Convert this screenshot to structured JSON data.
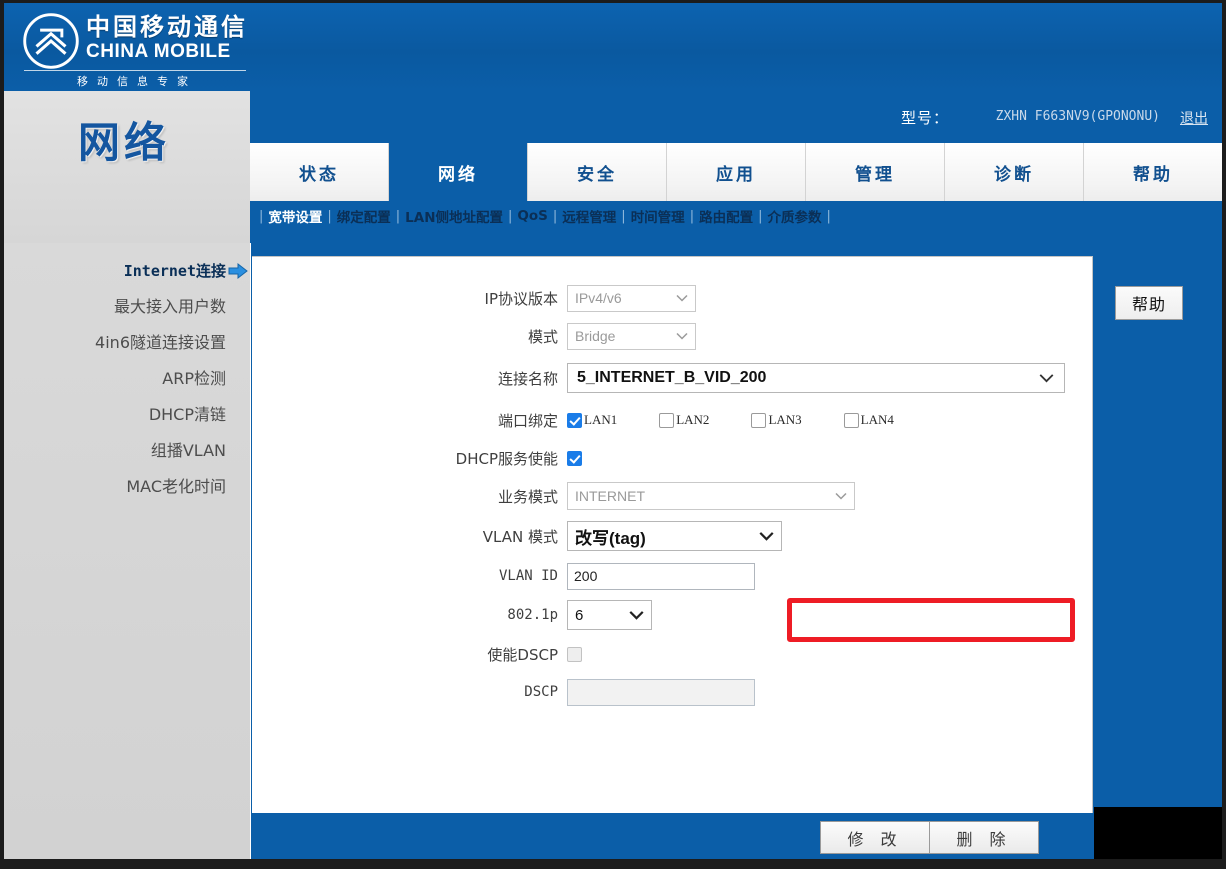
{
  "brand": {
    "name_cn": "中国移动通信",
    "name_en": "CHINA MOBILE",
    "slogan": "移动信息专家",
    "logo_icon": "china-mobile-logo-icon"
  },
  "header": {
    "model_label": "型号：",
    "model_value": "ZXHN F663NV9(GPONONU)",
    "logout_label": "退出"
  },
  "page": {
    "title": "网络"
  },
  "tabs": [
    {
      "label": "状态",
      "active": false
    },
    {
      "label": "网络",
      "active": true
    },
    {
      "label": "安全",
      "active": false
    },
    {
      "label": "应用",
      "active": false
    },
    {
      "label": "管理",
      "active": false
    },
    {
      "label": "诊断",
      "active": false
    },
    {
      "label": "帮助",
      "active": false
    }
  ],
  "subnav": [
    {
      "label": "宽带设置",
      "active": true
    },
    {
      "label": "绑定配置",
      "active": false
    },
    {
      "label": "LAN侧地址配置",
      "active": false
    },
    {
      "label": "QoS",
      "active": false
    },
    {
      "label": "远程管理",
      "active": false
    },
    {
      "label": "时间管理",
      "active": false
    },
    {
      "label": "路由配置",
      "active": false
    },
    {
      "label": "介质参数",
      "active": false
    }
  ],
  "sidebar": {
    "items": [
      {
        "label": "Internet连接",
        "active": true,
        "icon": "arrow-right-icon"
      },
      {
        "label": "最大接入用户数",
        "active": false
      },
      {
        "label": "4in6隧道连接设置",
        "active": false
      },
      {
        "label": "ARP检测",
        "active": false
      },
      {
        "label": "DHCP清链",
        "active": false
      },
      {
        "label": "组播VLAN",
        "active": false
      },
      {
        "label": "MAC老化时间",
        "active": false
      }
    ]
  },
  "form": {
    "ip_version": {
      "label": "IP协议版本",
      "value": "IPv4/v6",
      "disabled": true
    },
    "mode": {
      "label": "模式",
      "value": "Bridge",
      "disabled": true
    },
    "connection_name": {
      "label": "连接名称",
      "value": "5_INTERNET_B_VID_200",
      "disabled": false,
      "highlighted": true
    },
    "port_binding": {
      "label": "端口绑定",
      "ports": [
        {
          "label": "LAN1",
          "checked": true
        },
        {
          "label": "LAN2",
          "checked": false
        },
        {
          "label": "LAN3",
          "checked": false
        },
        {
          "label": "LAN4",
          "checked": false
        }
      ]
    },
    "dhcp_service": {
      "label": "DHCP服务使能",
      "checked": true
    },
    "service_mode": {
      "label": "业务模式",
      "value": "INTERNET",
      "disabled": true
    },
    "vlan_mode": {
      "label": "VLAN 模式",
      "value": "改写(tag)",
      "disabled": false
    },
    "vlan_id": {
      "label": "VLAN ID",
      "value": "200",
      "disabled": false
    },
    "dot1p": {
      "label": "802.1p",
      "value": "6",
      "disabled": false
    },
    "enable_dscp": {
      "label": "使能DSCP",
      "checked": false,
      "disabled": true
    },
    "dscp": {
      "label": "DSCP",
      "value": "",
      "disabled": true
    }
  },
  "actions": {
    "help_label": "帮助",
    "modify_label": "修 改",
    "delete_label": "删 除"
  },
  "colors": {
    "brand_blue": "#0b5ea8",
    "accent_red": "#ee1c25",
    "checkbox_blue": "#1a7ce8",
    "title_blue": "#1456a0"
  }
}
